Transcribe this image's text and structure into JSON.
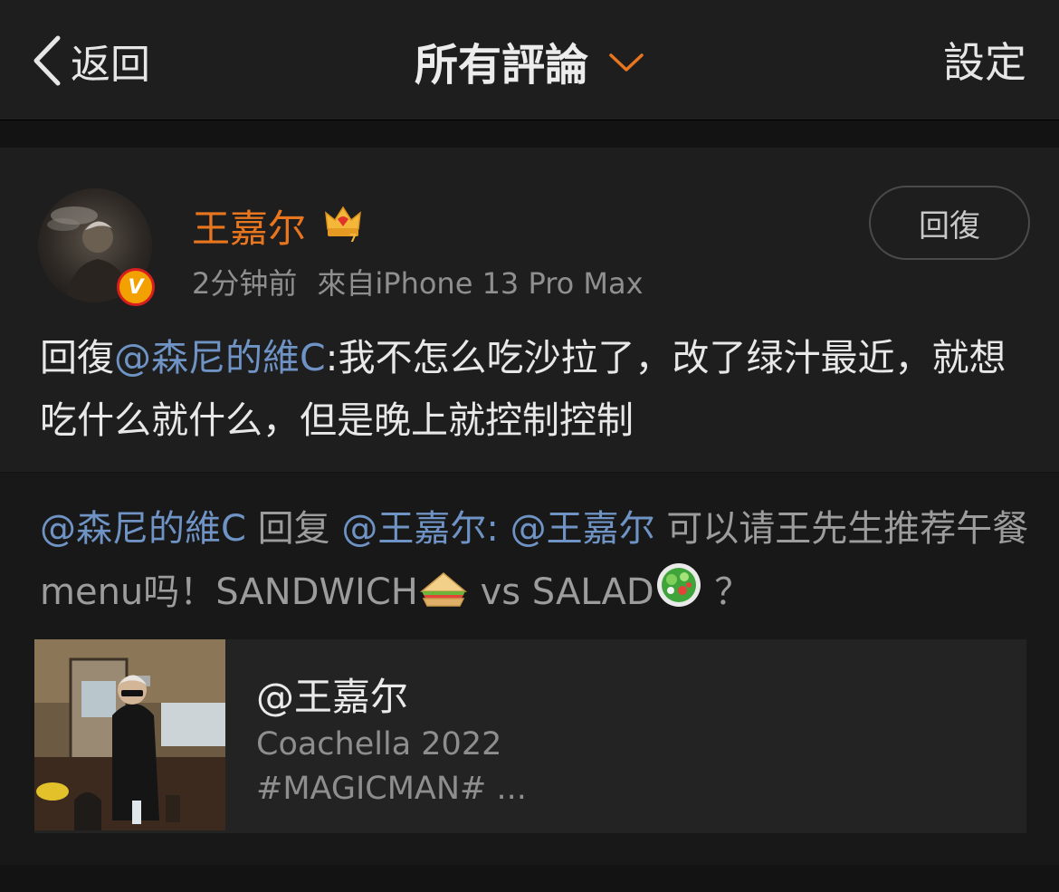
{
  "header": {
    "back_label": "返回",
    "title": "所有評論",
    "settings_label": "設定"
  },
  "comment": {
    "username": "王嘉尔",
    "time": "2分钟前",
    "source": "來自iPhone 13 Pro Max",
    "reply_button": "回復",
    "text_prefix": "回復",
    "mention": "@森尼的維C",
    "text_body": ":我不怎么吃沙拉了，改了绿汁最近，就想吃什么就什么，但是晚上就控制控制",
    "icons": {
      "verified": "verified-v-badge-icon",
      "crown": "crown-icon",
      "avatar": "avatar"
    },
    "colors": {
      "username": "#e8761f",
      "mention": "#6e93c4"
    }
  },
  "quoted": {
    "author": "@森尼的維C",
    "reply_word": "回复",
    "target": "@王嘉尔",
    "colon": ":",
    "mention2": "@王嘉尔",
    "text1": "可以请王先生推荐午餐menu吗！SANDWICH",
    "text2": "vs SALAD",
    "text3": "？",
    "emoji1": "sandwich-emoji",
    "emoji2": "salad-emoji"
  },
  "card": {
    "title": "@王嘉尔",
    "line1": "Coachella 2022",
    "line2": "#MAGICMAN# ..."
  }
}
